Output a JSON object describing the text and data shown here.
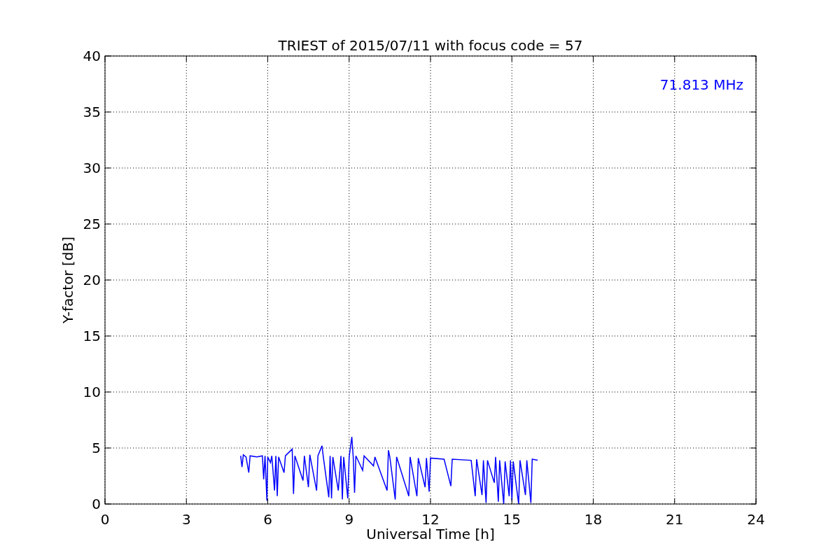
{
  "figure": {
    "chart_data": {
      "type": "line",
      "title": "TRIEST of 2015/07/11 with focus code = 57",
      "xlabel": "Universal Time [h]",
      "ylabel": "Y-factor [dB]",
      "xlim": [
        0,
        24
      ],
      "ylim": [
        0,
        40
      ],
      "xticks": [
        0,
        3,
        6,
        9,
        12,
        15,
        18,
        21,
        24
      ],
      "yticks": [
        0,
        5,
        10,
        15,
        20,
        25,
        30,
        35,
        40
      ],
      "x": [
        5.0,
        5.05,
        5.1,
        5.2,
        5.3,
        5.35,
        5.6,
        5.8,
        5.85,
        5.9,
        5.97,
        6.0,
        6.1,
        6.15,
        6.25,
        6.3,
        6.35,
        6.4,
        6.6,
        6.65,
        6.9,
        6.95,
        7.0,
        7.3,
        7.35,
        7.5,
        7.55,
        7.8,
        7.85,
        8.0,
        8.05,
        8.25,
        8.3,
        8.35,
        8.4,
        8.6,
        8.7,
        8.75,
        8.8,
        8.95,
        9.0,
        9.1,
        9.15,
        9.2,
        9.25,
        9.5,
        9.55,
        9.9,
        9.95,
        10.4,
        10.45,
        10.5,
        10.7,
        10.75,
        11.2,
        11.25,
        11.5,
        11.55,
        11.8,
        11.85,
        11.95,
        12.0,
        12.5,
        12.75,
        12.8,
        13.5,
        13.65,
        13.7,
        13.9,
        13.95,
        14.05,
        14.1,
        14.35,
        14.4,
        14.5,
        14.55,
        14.7,
        14.75,
        14.9,
        14.95,
        15.0,
        15.05,
        15.25,
        15.3,
        15.5,
        15.55,
        15.7,
        15.75,
        15.95
      ],
      "series": [
        {
          "color": "#0000ff",
          "values": [
            4.3,
            3.3,
            4.4,
            4.2,
            2.8,
            4.3,
            4.2,
            4.3,
            2.2,
            4.3,
            0.3,
            4.2,
            3.7,
            4.3,
            1.2,
            4.3,
            0.7,
            4.2,
            2.8,
            4.3,
            4.9,
            0.9,
            4.3,
            2.1,
            4.3,
            1.5,
            4.4,
            1.2,
            4.3,
            5.2,
            4.2,
            0.6,
            4.3,
            0.5,
            4.2,
            1.2,
            4.3,
            0.4,
            4.2,
            0.5,
            4.2,
            6.0,
            4.2,
            1.0,
            4.3,
            3.0,
            4.3,
            3.4,
            4.2,
            1.2,
            4.8,
            4.2,
            0.4,
            4.2,
            0.7,
            4.2,
            0.7,
            4.1,
            1.5,
            4.1,
            1.1,
            4.1,
            4.0,
            1.6,
            4.0,
            3.9,
            0.7,
            4.0,
            0.8,
            3.9,
            0.1,
            3.9,
            1.9,
            4.2,
            0.2,
            3.9,
            0.0,
            3.8,
            0.7,
            3.9,
            0.3,
            3.8,
            0.0,
            3.9,
            0.8,
            3.9,
            0.1,
            4.0,
            3.9
          ]
        }
      ],
      "grid": true,
      "annotations": [
        "71.813 MHz"
      ]
    }
  }
}
